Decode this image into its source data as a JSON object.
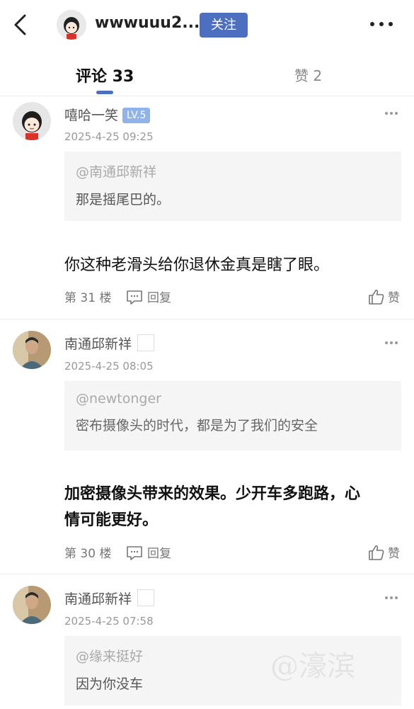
{
  "header": {
    "back_icon": "chevron-left-icon",
    "username": "wwwuuu2...",
    "follow_label": "关注",
    "more_icon": "more-horizontal-icon",
    "accent_color": "#4d6fc0"
  },
  "tabs": {
    "comments_label": "评论 33",
    "likes_label": "赞 2"
  },
  "comments": [
    {
      "user": "嘻哈一笑",
      "level_badge": "LV.5",
      "time": "2025-4-25 09:25",
      "quote_handle": "@南通邱新祥",
      "quote_text": "那是摇尾巴的。",
      "body": "你这种老滑头给你退休金真是瞎了眼。",
      "floor": "第 31 楼",
      "reply_label": "回复",
      "like_label": "赞"
    },
    {
      "user": "南通邱新祥",
      "time": "2025-4-25 08:05",
      "quote_handle": "@newtonger",
      "quote_text": "密布摄像头的时代，都是为了我们的安全",
      "body_line1": "加密摄像头带来的效果。少开车多跑路，心",
      "body_line2": "情可能更好。",
      "floor": "第 30 楼",
      "reply_label": "回复",
      "like_label": "赞"
    },
    {
      "user": "南通邱新祥",
      "time": "2025-4-25 07:58",
      "quote_handle": "@缘来挺好",
      "quote_text": "因为你没车"
    }
  ],
  "watermark": "@濠滨"
}
